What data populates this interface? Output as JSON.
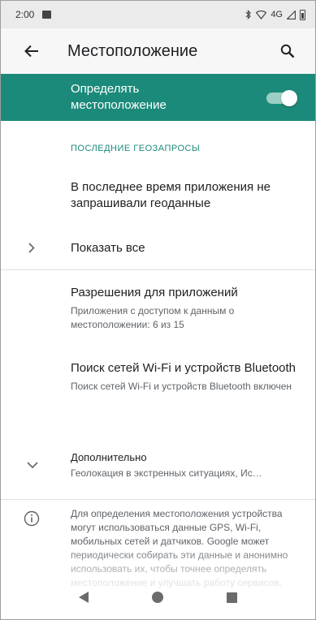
{
  "status_bar": {
    "time": "2:00",
    "network": "4G"
  },
  "app_bar": {
    "title": "Местоположение",
    "back_icon": "arrow-left-icon",
    "search_icon": "search-icon"
  },
  "master_toggle": {
    "label": "Определять местоположение",
    "enabled": true,
    "accent_color": "#1c8a7a"
  },
  "recent_requests": {
    "header": "ПОСЛЕДНИЕ ГЕОЗАПРОСЫ",
    "empty_text": "В последнее время приложения не запрашивали геоданные",
    "show_all_label": "Показать все"
  },
  "app_permissions": {
    "title": "Разрешения для приложений",
    "summary": "Приложения с доступом к данным о местоположении: 6 из 15"
  },
  "scanning": {
    "title": "Поиск сетей Wi‑Fi и устройств Bluetooth",
    "summary": "Поиск сетей Wi‑Fi и устройств Bluetooth включен"
  },
  "advanced": {
    "title": "Дополнительно",
    "summary": "Геолокация в экстренных ситуациях, Ис…"
  },
  "info": {
    "text": "Для определения местоположения устройства могут использоваться данные GPS, Wi‑Fi, мобильных сетей и датчиков. Google может периодически собирать эти данные и анонимно использовать их, чтобы точнее определять местоположение и улучшать работу сервисов."
  }
}
